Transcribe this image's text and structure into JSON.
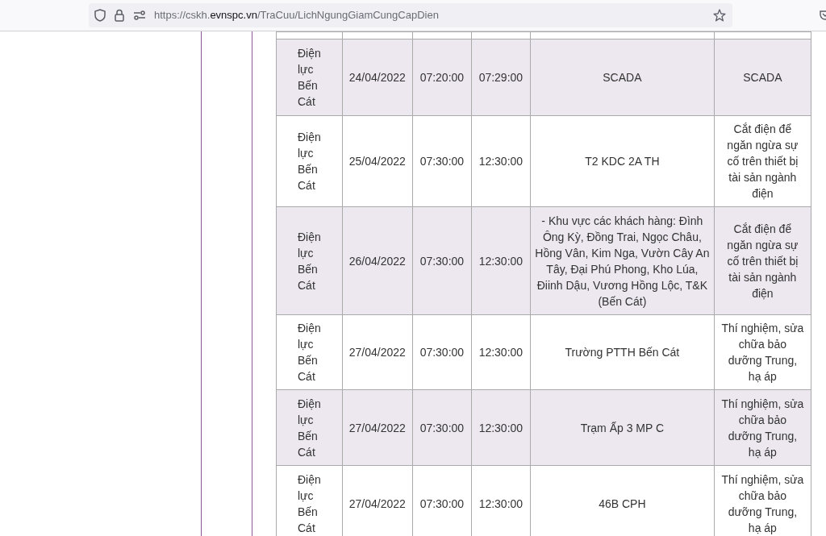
{
  "address_bar": {
    "url": "https://cskh.**evnspc.vn**/TraCuu/LichNgungGiamCungCapDien"
  },
  "table": {
    "rows": [
      {
        "unit": "Điện lực Bến Cát",
        "date": "24/04/2022",
        "start": "07:20:00",
        "end": "07:29:00",
        "area": "SCADA",
        "reason": "SCADA"
      },
      {
        "unit": "Điện lực Bến Cát",
        "date": "25/04/2022",
        "start": "07:30:00",
        "end": "12:30:00",
        "area": "T2 KDC 2A TH",
        "reason": "Cắt điện để ngăn ngừa sự cố trên thiết bị tài sản ngành điện"
      },
      {
        "unit": "Điện lực Bến Cát",
        "date": "26/04/2022",
        "start": "07:30:00",
        "end": "12:30:00",
        "area": "- Khu vực các khách hàng: Đình Ông Kỳ, Đồng Trai, Ngọc Châu, Hồng Vân, Kim Nga, Vườn Cây An Tây, Đại Phú Phong, Kho Lúa, Điinh Dậu, Vương Hồng Lộc, T&K (Bến Cát)",
        "reason": "Cắt điện để ngăn ngừa sự cố trên thiết bị tài sản ngành điện"
      },
      {
        "unit": "Điện lực Bến Cát",
        "date": "27/04/2022",
        "start": "07:30:00",
        "end": "12:30:00",
        "area": "Trường PTTH Bến Cát",
        "reason": "Thí nghiệm, sửa chữa bảo dưỡng Trung, hạ áp"
      },
      {
        "unit": "Điện lực Bến Cát",
        "date": "27/04/2022",
        "start": "07:30:00",
        "end": "12:30:00",
        "area": "Trạm Ấp 3 MP C",
        "reason": "Thí nghiệm, sửa chữa bảo dưỡng Trung, hạ áp"
      },
      {
        "unit": "Điện lực Bến Cát",
        "date": "27/04/2022",
        "start": "07:30:00",
        "end": "12:30:00",
        "area": "46B CPH",
        "reason": "Thí nghiệm, sửa chữa bảo dưỡng Trung, hạ áp"
      }
    ]
  }
}
